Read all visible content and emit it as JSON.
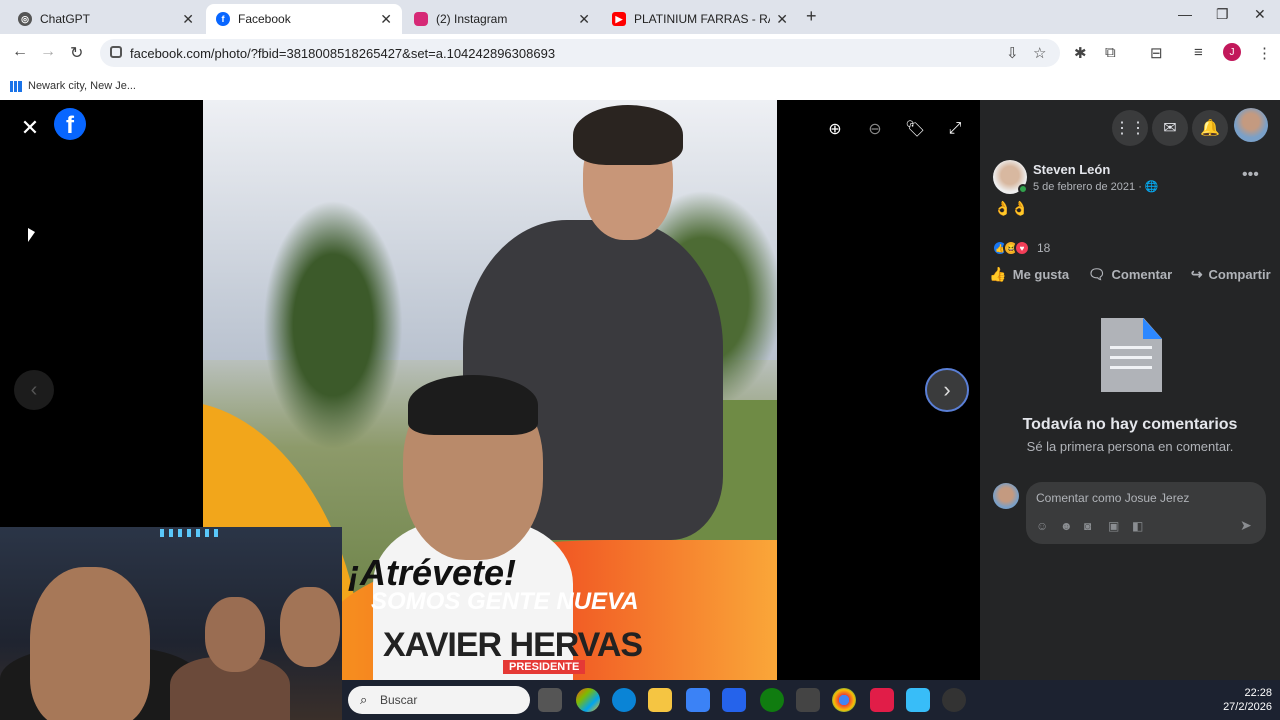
{
  "tabs": [
    {
      "title": "ChatGPT",
      "close": "✕"
    },
    {
      "title": "Facebook",
      "close": "✕"
    },
    {
      "title": "(2) Instagram",
      "close": "✕"
    },
    {
      "title": "PLATINIUM FARRAS - RAKATA",
      "close": "✕"
    }
  ],
  "browser": {
    "url": "facebook.com/photo/?fbid=3818008518265427&set=a.104242896308693",
    "bookmark": "Newark city, New Je...",
    "profile_initial": "J",
    "new_tab": "+"
  },
  "viewer": {
    "close": "✕",
    "logo": "f",
    "poster": {
      "line1": "¡Atrévete!",
      "line2": "SOMOS GENTE NUEVA",
      "line3": "XAVIER HERVAS",
      "tag": "PRESIDENTE"
    },
    "prev": "‹",
    "next": "›",
    "zoom_in": "⊕",
    "zoom_out": "⊖",
    "tag_icon": "🏷",
    "fullscreen": "⤢"
  },
  "post": {
    "author": "Steven León",
    "date": "5 de febrero de 2021 · 🌐",
    "text": "👌👌",
    "reaction_count": "18",
    "actions": {
      "like": "Me gusta",
      "comment": "Comentar",
      "share": "Compartir"
    },
    "more": "•••",
    "no_comments_title": "Todavía no hay comentarios",
    "no_comments_sub": "Sé la primera persona en comentar.",
    "comment_placeholder": "Comentar como Josue Jerez"
  },
  "taskbar": {
    "search_placeholder": "Buscar",
    "time": "22:28",
    "date": "27/2/2026"
  },
  "colors": {
    "fb_blue": "#0866ff",
    "panel_bg": "#242526",
    "chip_bg": "#3a3b3c"
  }
}
